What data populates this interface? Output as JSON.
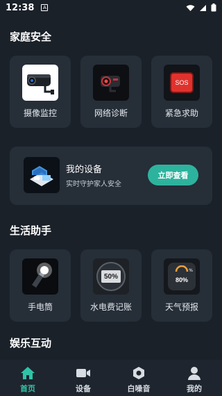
{
  "status": {
    "time": "12:38",
    "notif_glyph": "A"
  },
  "sections": {
    "home_security": "家庭安全",
    "life_helper": "生活助手",
    "entertainment": "娱乐互动"
  },
  "home_security_items": [
    {
      "label": "摄像监控",
      "icon": "camera-icon"
    },
    {
      "label": "网络诊断",
      "icon": "network-camera-icon"
    },
    {
      "label": "紧急求助",
      "icon": "sos-icon",
      "icon_text": "SOS"
    }
  ],
  "device_card": {
    "title": "我的设备",
    "subtitle": "实时守护家人安全",
    "button": "立即查看"
  },
  "life_items": [
    {
      "label": "手电筒",
      "icon": "flashlight-icon"
    },
    {
      "label": "水电费记账",
      "icon": "meter-icon",
      "icon_text": "50%"
    },
    {
      "label": "天气预报",
      "icon": "weather-icon",
      "icon_text": "80%",
      "icon_sub": "%"
    }
  ],
  "tabs": [
    {
      "label": "首页",
      "icon": "home-icon",
      "active": true
    },
    {
      "label": "设备",
      "icon": "video-icon",
      "active": false
    },
    {
      "label": "白噪音",
      "icon": "hexagon-nut-icon",
      "active": false
    },
    {
      "label": "我的",
      "icon": "person-icon",
      "active": false
    }
  ],
  "colors": {
    "background": "#1b2129",
    "card": "#262e38",
    "accent": "#2db39d",
    "sos": "#e0322d"
  }
}
